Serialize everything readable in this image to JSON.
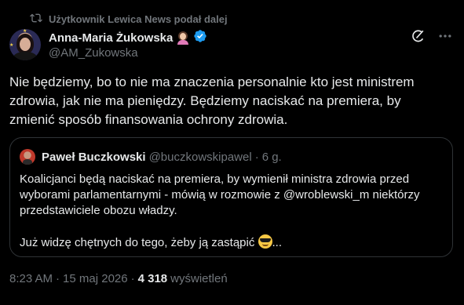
{
  "repost": {
    "icon": "repost-icon",
    "text": "Użytkownik Lewica News podał dalej"
  },
  "author": {
    "name": "Anna-Maria Żukowska",
    "name_emoji": "woman-tipping-hand-emoji",
    "verified_icon": "verified-badge-icon",
    "handle": "@AM_Zukowska"
  },
  "toolbar": {
    "grok_icon": "grok-icon",
    "more_icon": "more-options-icon"
  },
  "tweet": {
    "text": "Nie będziemy, bo to nie ma znaczenia personalnie kto jest ministrem zdrowia, jak nie ma pieniędzy. Będziemy naciskać na premiera, by zmienić sposób finansowania ochrony zdrowia."
  },
  "quote": {
    "name": "Paweł Buczkowski",
    "handle": "@buczkowskipawel",
    "separator": "·",
    "time": "6 g.",
    "paragraph1": "Koalicjanci będą naciskać na premiera, by wymienił ministra zdrowia przed wyborami parlamentarnymi - mówią w rozmowie z @wroblewski_m niektórzy przedstawiciele obozu władzy.",
    "paragraph2_text": "Już widzę chętnych do tego, żeby ją zastąpić",
    "paragraph2_emoji": "smiling-face-with-sunglasses-emoji",
    "paragraph2_suffix": "..."
  },
  "footer": {
    "time": "8:23 AM",
    "separator": "·",
    "date": "15 maj 2026",
    "views_count": "4 318",
    "views_label": "wyświetleń"
  },
  "colors": {
    "background": "#000000",
    "text": "#e7e9ea",
    "muted": "#71767b",
    "border": "#2f3336",
    "verified": "#1d9bf0"
  }
}
